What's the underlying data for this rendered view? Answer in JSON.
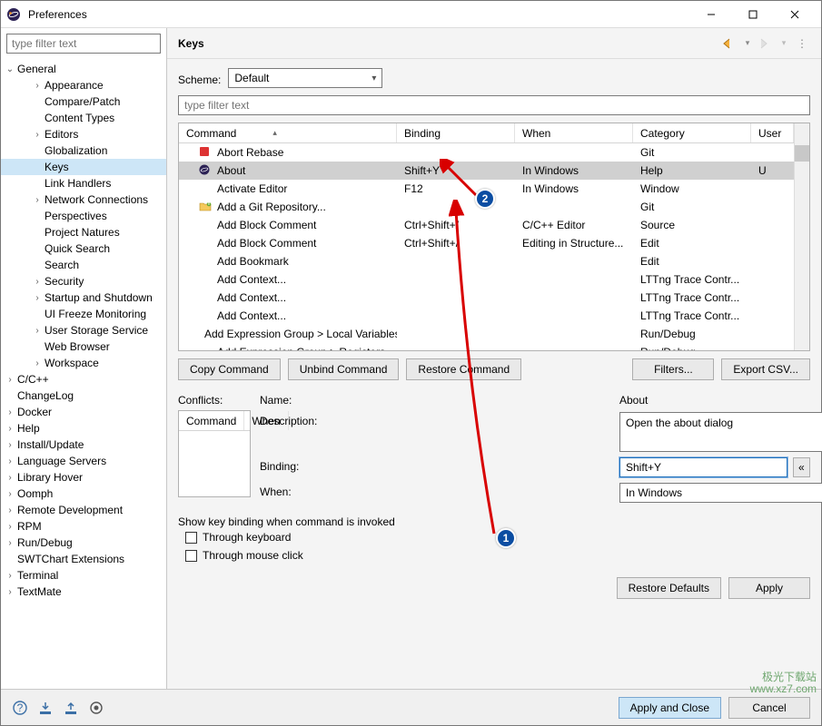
{
  "window": {
    "title": "Preferences"
  },
  "left": {
    "filter_placeholder": "type filter text",
    "tree": [
      {
        "label": "General",
        "level": 0,
        "exp": "open",
        "kids": [
          {
            "label": "Appearance",
            "tw": ">"
          },
          {
            "label": "Compare/Patch"
          },
          {
            "label": "Content Types"
          },
          {
            "label": "Editors",
            "tw": ">"
          },
          {
            "label": "Globalization"
          },
          {
            "label": "Keys",
            "sel": true
          },
          {
            "label": "Link Handlers"
          },
          {
            "label": "Network Connections",
            "tw": ">"
          },
          {
            "label": "Perspectives"
          },
          {
            "label": "Project Natures"
          },
          {
            "label": "Quick Search"
          },
          {
            "label": "Search"
          },
          {
            "label": "Security",
            "tw": ">"
          },
          {
            "label": "Startup and Shutdown",
            "tw": ">"
          },
          {
            "label": "UI Freeze Monitoring"
          },
          {
            "label": "User Storage Service",
            "tw": ">"
          },
          {
            "label": "Web Browser"
          },
          {
            "label": "Workspace",
            "tw": ">"
          }
        ]
      },
      {
        "label": "C/C++",
        "tw": ">"
      },
      {
        "label": "ChangeLog"
      },
      {
        "label": "Docker",
        "tw": ">"
      },
      {
        "label": "Help",
        "tw": ">"
      },
      {
        "label": "Install/Update",
        "tw": ">"
      },
      {
        "label": "Language Servers",
        "tw": ">"
      },
      {
        "label": "Library Hover",
        "tw": ">"
      },
      {
        "label": "Oomph",
        "tw": ">"
      },
      {
        "label": "Remote Development",
        "tw": ">"
      },
      {
        "label": "RPM",
        "tw": ">"
      },
      {
        "label": "Run/Debug",
        "tw": ">"
      },
      {
        "label": "SWTChart Extensions"
      },
      {
        "label": "Terminal",
        "tw": ">"
      },
      {
        "label": "TextMate",
        "tw": ">"
      }
    ]
  },
  "right": {
    "title": "Keys",
    "scheme_label": "Scheme:",
    "scheme_value": "Default",
    "table_filter_placeholder": "type filter text",
    "columns": {
      "cmd": "Command",
      "bind": "Binding",
      "when": "When",
      "cat": "Category",
      "user": "User"
    },
    "rows": [
      {
        "cmd": "Abort Rebase",
        "bind": "",
        "when": "",
        "cat": "Git",
        "user": "",
        "icon": "red"
      },
      {
        "cmd": "About",
        "bind": "Shift+Y",
        "when": "In Windows",
        "cat": "Help",
        "user": "U",
        "sel": true,
        "icon": "eclipse"
      },
      {
        "cmd": "Activate Editor",
        "bind": "F12",
        "when": "In Windows",
        "cat": "Window",
        "user": ""
      },
      {
        "cmd": "Add a Git Repository...",
        "bind": "",
        "when": "",
        "cat": "Git",
        "user": "",
        "icon": "folder"
      },
      {
        "cmd": "Add Block Comment",
        "bind": "Ctrl+Shift+/",
        "when": "C/C++ Editor",
        "cat": "Source",
        "user": ""
      },
      {
        "cmd": "Add Block Comment",
        "bind": "Ctrl+Shift+/",
        "when": "Editing in Structure...",
        "cat": "Edit",
        "user": ""
      },
      {
        "cmd": "Add Bookmark",
        "bind": "",
        "when": "",
        "cat": "Edit",
        "user": ""
      },
      {
        "cmd": "Add Context...",
        "bind": "",
        "when": "",
        "cat": "LTTng Trace Contr...",
        "user": ""
      },
      {
        "cmd": "Add Context...",
        "bind": "",
        "when": "",
        "cat": "LTTng Trace Contr...",
        "user": ""
      },
      {
        "cmd": "Add Context...",
        "bind": "",
        "when": "",
        "cat": "LTTng Trace Contr...",
        "user": ""
      },
      {
        "cmd": "Add Expression Group > Local Variables",
        "bind": "",
        "when": "",
        "cat": "Run/Debug",
        "user": ""
      },
      {
        "cmd": "Add Expression Group > Registers",
        "bind": "",
        "when": "",
        "cat": "Run/Debug",
        "user": ""
      }
    ],
    "buttons": {
      "copy": "Copy Command",
      "unbind": "Unbind Command",
      "restore": "Restore Command",
      "filters": "Filters...",
      "export": "Export CSV..."
    },
    "form": {
      "name_label": "Name:",
      "name_value": "About",
      "desc_label": "Description:",
      "desc_value": "Open the about dialog",
      "bind_label": "Binding:",
      "bind_value": "Shift+Y",
      "when_label": "When:",
      "when_value": "In Windows",
      "clear": "«",
      "conflicts_label": "Conflicts:",
      "conf_cols": {
        "cmd": "Command",
        "when": "When"
      }
    },
    "show": {
      "title": "Show key binding when command is invoked",
      "kb": "Through keyboard",
      "mc": "Through mouse click"
    },
    "defaults": "Restore Defaults",
    "apply": "Apply"
  },
  "footer": {
    "apply_close": "Apply and Close",
    "cancel": "Cancel"
  },
  "annotations": {
    "b1": "1",
    "b2": "2"
  },
  "watermark": {
    "l1": "极光下载站",
    "l2": "www.xz7.com"
  }
}
